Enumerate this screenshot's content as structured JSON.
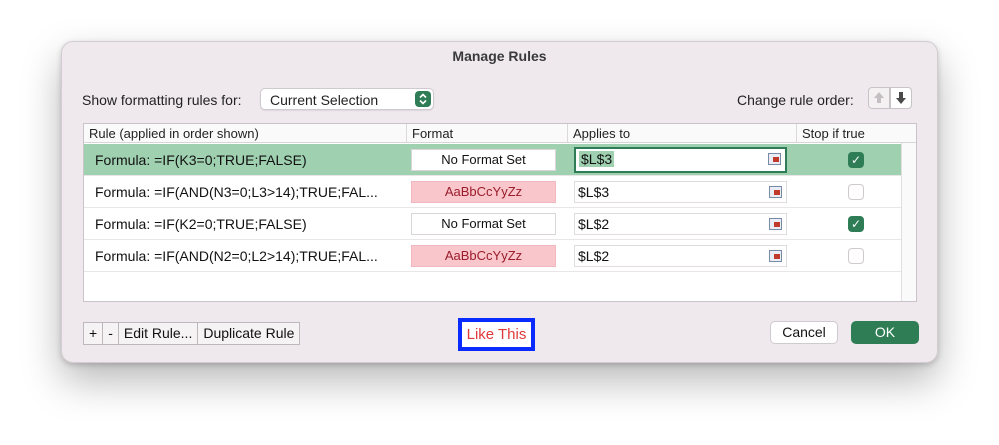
{
  "dialog": {
    "title": "Manage Rules"
  },
  "filter": {
    "label": "Show formatting rules for:",
    "selected": "Current Selection"
  },
  "order": {
    "label": "Change rule order:",
    "up_icon": "arrow-up-icon",
    "down_icon": "arrow-down-icon"
  },
  "table": {
    "headers": [
      "Rule (applied in order shown)",
      "Format",
      "Applies to",
      "Stop if true"
    ],
    "rows": [
      {
        "rule": "Formula: =IF(K3=0;TRUE;FALSE)",
        "format": "No Format Set",
        "applies_to": "$L$3",
        "stop_if_true": true
      },
      {
        "rule": "Formula: =IF(AND(N3=0;L3>14);TRUE;FAL...",
        "format": "AaBbCcYyZz",
        "applies_to": "$L$3",
        "stop_if_true": false
      },
      {
        "rule": "Formula: =IF(K2=0;TRUE;FALSE)",
        "format": "No Format Set",
        "applies_to": "$L$2",
        "stop_if_true": true
      },
      {
        "rule": "Formula: =IF(AND(N2=0;L2>14);TRUE;FAL...",
        "format": "AaBbCcYyZz",
        "applies_to": "$L$2",
        "stop_if_true": false
      }
    ]
  },
  "buttons": {
    "add": "+",
    "remove": "-",
    "edit": "Edit Rule...",
    "duplicate": "Duplicate Rule",
    "cancel": "Cancel",
    "ok": "OK"
  },
  "annotation": {
    "text": "Like This"
  },
  "colors": {
    "accent_green": "#2e7d55",
    "selected_row": "#9fd0b0",
    "preview_pink": "#f9c6cc",
    "annotation_blue": "#0a2bff",
    "annotation_text": "#e0393b"
  }
}
